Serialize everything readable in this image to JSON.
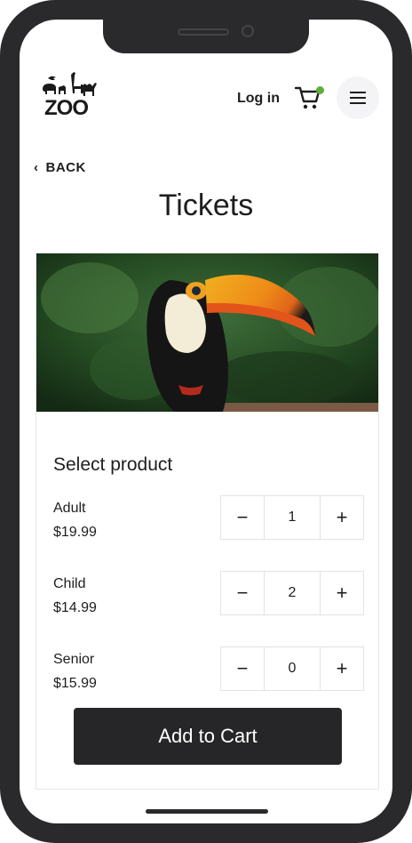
{
  "header": {
    "logo_text": "ZOO",
    "login_label": "Log in",
    "cart_icon": "cart-icon",
    "cart_badge_color": "#5fae3a",
    "menu_icon": "hamburger-menu-icon"
  },
  "nav": {
    "back_label": "BACK"
  },
  "page": {
    "title": "Tickets"
  },
  "product": {
    "hero_image": "toucan",
    "select_title": "Select product",
    "items": [
      {
        "name": "Adult",
        "price": "$19.99",
        "quantity": "1",
        "minus": "−",
        "plus": "+"
      },
      {
        "name": "Child",
        "price": "$14.99",
        "quantity": "2",
        "minus": "−",
        "plus": "+"
      },
      {
        "name": "Senior",
        "price": "$15.99",
        "quantity": "0",
        "minus": "−",
        "plus": "+"
      }
    ],
    "add_to_cart_label": "Add to Cart"
  },
  "colors": {
    "button_dark": "#262628",
    "phone_frame": "#2a2a2c"
  }
}
